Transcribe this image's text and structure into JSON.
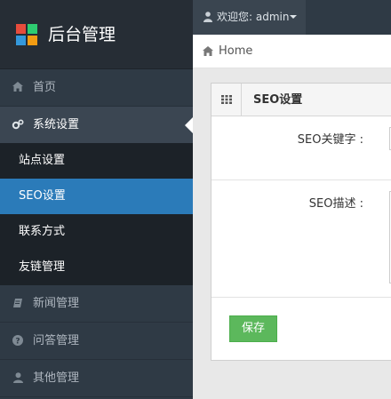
{
  "brand": {
    "title": "后台管理",
    "logo_icon": "windows-logo-icon"
  },
  "topbar": {
    "user_greeting": "欢迎您: admin"
  },
  "breadcrumb": {
    "home": "Home"
  },
  "sidebar": {
    "items": [
      {
        "label": "首页",
        "icon": "home-icon"
      },
      {
        "label": "系统设置",
        "icon": "cogs-icon",
        "active": true
      },
      {
        "label": "新闻管理",
        "icon": "book-icon"
      },
      {
        "label": "问答管理",
        "icon": "question-icon"
      },
      {
        "label": "其他管理",
        "icon": "user-icon"
      }
    ],
    "sub_items": [
      {
        "label": "站点设置"
      },
      {
        "label": "SEO设置",
        "active": true
      },
      {
        "label": "联系方式"
      },
      {
        "label": "友链管理"
      }
    ]
  },
  "panel": {
    "title": "SEO设置",
    "keywords_label": "SEO关键字 :",
    "description_label": "SEO描述 :",
    "save_label": "保存"
  },
  "colors": {
    "accent": "#2b7bb9",
    "save": "#5cb85c",
    "sidebar": "#2f3a45"
  }
}
